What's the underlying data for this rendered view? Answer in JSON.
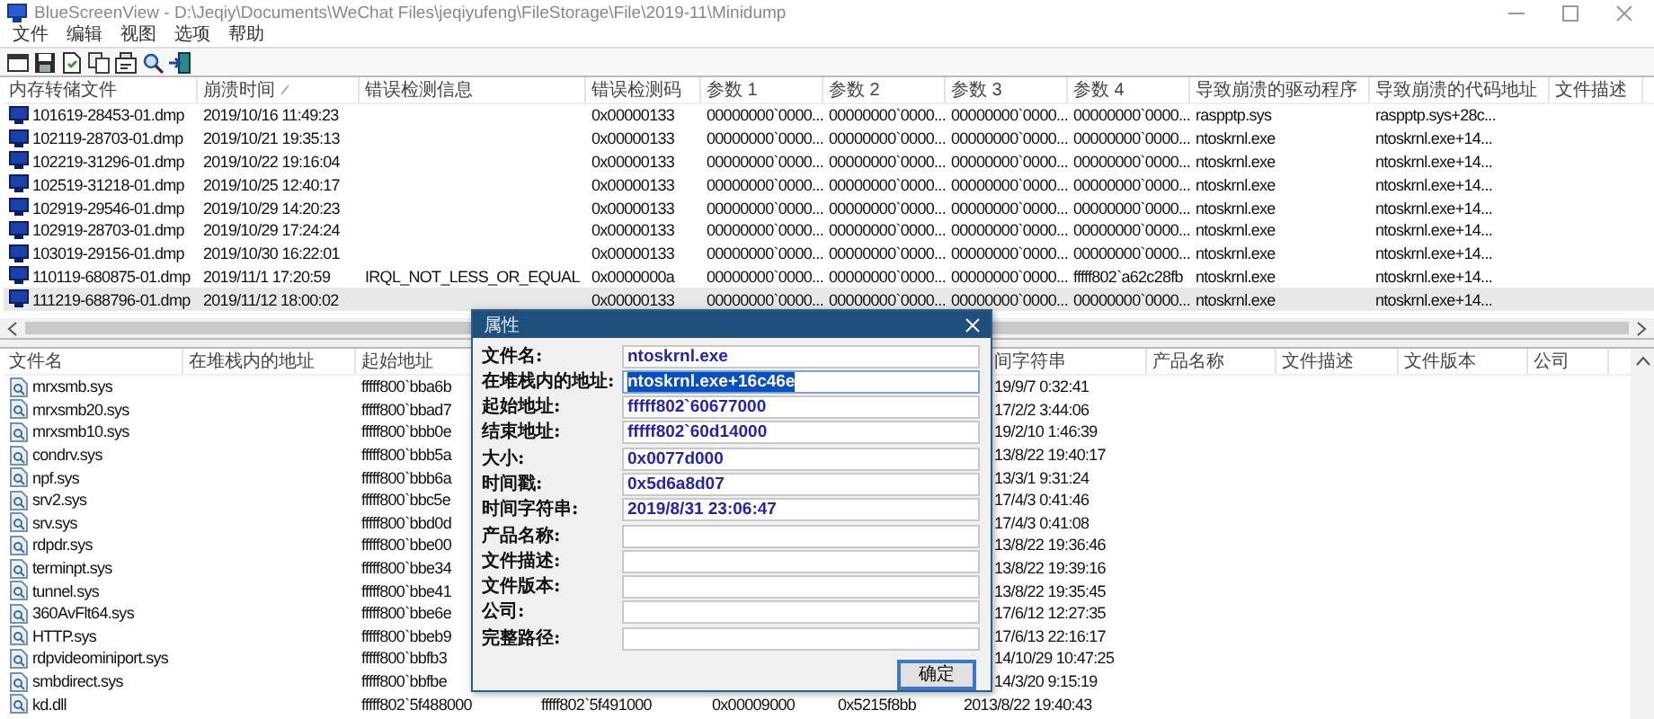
{
  "window": {
    "title": "BlueScreenView  -  D:\\Jeqiy\\Documents\\WeChat Files\\jeqiyufeng\\FileStorage\\File\\2019-11\\Minidump"
  },
  "menu": [
    "文件",
    "编辑",
    "视图",
    "选项",
    "帮助"
  ],
  "crash_list": {
    "columns": [
      {
        "label": "内存转储文件",
        "sorted": false
      },
      {
        "label": "崩溃时间",
        "sorted": true
      },
      {
        "label": "错误检测信息",
        "sorted": false
      },
      {
        "label": "错误检测码",
        "sorted": false
      },
      {
        "label": "参数 1",
        "sorted": false
      },
      {
        "label": "参数 2",
        "sorted": false
      },
      {
        "label": "参数 3",
        "sorted": false
      },
      {
        "label": "参数 4",
        "sorted": false
      },
      {
        "label": "导致崩溃的驱动程序",
        "sorted": false
      },
      {
        "label": "导致崩溃的代码地址",
        "sorted": false
      },
      {
        "label": "文件描述",
        "sorted": false
      }
    ],
    "rows": [
      {
        "file": "101619-28453-01.dmp",
        "time": "2019/10/16 11:49:23",
        "code": "0x00000133",
        "param1": "00000000`0000...",
        "param2": "00000000`0000...",
        "param3": "00000000`0000...",
        "param4": "00000000`0000...",
        "driver": "raspptp.sys",
        "address": "raspptp.sys+28c...",
        "selected": false
      },
      {
        "file": "102119-28703-01.dmp",
        "time": "2019/10/21 19:35:13",
        "code": "0x00000133",
        "param1": "00000000`0000...",
        "param2": "00000000`0000...",
        "param3": "00000000`0000...",
        "param4": "00000000`0000...",
        "driver": "ntoskrnl.exe",
        "address": "ntoskrnl.exe+14...",
        "selected": false
      },
      {
        "file": "102219-31296-01.dmp",
        "time": "2019/10/22 19:16:04",
        "code": "0x00000133",
        "param1": "00000000`0000...",
        "param2": "00000000`0000...",
        "param3": "00000000`0000...",
        "param4": "00000000`0000...",
        "driver": "ntoskrnl.exe",
        "address": "ntoskrnl.exe+14...",
        "selected": false
      },
      {
        "file": "102519-31218-01.dmp",
        "time": "2019/10/25 12:40:17",
        "code": "0x00000133",
        "param1": "00000000`0000...",
        "param2": "00000000`0000...",
        "param3": "00000000`0000...",
        "param4": "00000000`0000...",
        "driver": "ntoskrnl.exe",
        "address": "ntoskrnl.exe+14...",
        "selected": false
      },
      {
        "file": "102919-29546-01.dmp",
        "time": "2019/10/29 14:20:23",
        "code": "0x00000133",
        "param1": "00000000`0000...",
        "param2": "00000000`0000...",
        "param3": "00000000`0000...",
        "param4": "00000000`0000...",
        "driver": "ntoskrnl.exe",
        "address": "ntoskrnl.exe+14...",
        "selected": false
      },
      {
        "file": "102919-28703-01.dmp",
        "time": "2019/10/29 17:24:24",
        "code": "0x00000133",
        "param1": "00000000`0000...",
        "param2": "00000000`0000...",
        "param3": "00000000`0000...",
        "param4": "00000000`0000...",
        "driver": "ntoskrnl.exe",
        "address": "ntoskrnl.exe+14...",
        "selected": false
      },
      {
        "file": "103019-29156-01.dmp",
        "time": "2019/10/30 16:22:01",
        "code": "0x00000133",
        "param1": "00000000`0000...",
        "param2": "00000000`0000...",
        "param3": "00000000`0000...",
        "param4": "00000000`0000...",
        "driver": "ntoskrnl.exe",
        "address": "ntoskrnl.exe+14...",
        "selected": false
      },
      {
        "file": "110119-680875-01.dmp",
        "time": "2019/11/1 17:20:59",
        "message": "IRQL_NOT_LESS_OR_EQUAL",
        "code": "0x0000000a",
        "param1": "00000000`0000...",
        "param2": "00000000`0000...",
        "param3": "00000000`0000...",
        "param4": "fffff802`a62c28fb",
        "driver": "ntoskrnl.exe",
        "address": "ntoskrnl.exe+14...",
        "selected": false
      },
      {
        "file": "111219-688796-01.dmp",
        "time": "2019/11/12 18:00:02",
        "code": "0x00000133",
        "param1": "00000000`0000...",
        "param2": "00000000`0000...",
        "param3": "00000000`0000...",
        "param4": "00000000`0000...",
        "driver": "ntoskrnl.exe",
        "address": "ntoskrnl.exe+14...",
        "selected": true
      }
    ]
  },
  "module_list": {
    "columns_left": [
      "文件名",
      "在堆栈内的地址",
      "起始地址"
    ],
    "columns_right": [
      "间字符串",
      "产品名称",
      "文件描述",
      "文件版本",
      "公司"
    ],
    "rows": [
      {
        "name": "mrxsmb.sys",
        "start_address": "fffff800`bba6b",
        "time_string": "19/9/7 0:32:41",
        "covered": true
      },
      {
        "name": "mrxsmb20.sys",
        "start_address": "fffff800`bbad7",
        "time_string": "17/2/2 3:44:06",
        "covered": true
      },
      {
        "name": "mrxsmb10.sys",
        "start_address": "fffff800`bbb0e",
        "time_string": "19/2/10 1:46:39",
        "covered": true
      },
      {
        "name": "condrv.sys",
        "start_address": "fffff800`bbb5a",
        "time_string": "13/8/22 19:40:17",
        "covered": true
      },
      {
        "name": "npf.sys",
        "start_address": "fffff800`bbb6a",
        "time_string": "13/3/1 9:31:24",
        "covered": true
      },
      {
        "name": "srv2.sys",
        "start_address": "fffff800`bbc5e",
        "time_string": "17/4/3 0:41:46",
        "covered": true
      },
      {
        "name": "srv.sys",
        "start_address": "fffff800`bbd0d",
        "time_string": "17/4/3 0:41:08",
        "covered": true
      },
      {
        "name": "rdpdr.sys",
        "start_address": "fffff800`bbe00",
        "time_string": "13/8/22 19:36:46",
        "covered": true
      },
      {
        "name": "terminpt.sys",
        "start_address": "fffff800`bbe34",
        "time_string": "13/8/22 19:39:16",
        "covered": true
      },
      {
        "name": "tunnel.sys",
        "start_address": "fffff800`bbe41",
        "time_string": "13/8/22 19:35:45",
        "covered": true
      },
      {
        "name": "360AvFlt64.sys",
        "start_address": "fffff800`bbe6e",
        "time_string": "17/6/12 12:27:35",
        "covered": true
      },
      {
        "name": "HTTP.sys",
        "start_address": "fffff800`bbeb9",
        "time_string": "17/6/13 22:16:17",
        "covered": true
      },
      {
        "name": "rdpvideominiport.sys",
        "start_address": "fffff800`bbfb3",
        "time_string": "14/10/29 10:47:25",
        "covered": true
      },
      {
        "name": "smbdirect.sys",
        "start_address": "fffff800`bbfbe",
        "time_string": "14/3/20 9:15:19",
        "covered": true
      },
      {
        "name": "kd.dll",
        "start_address": "fffff802`5f488000",
        "end_address": "fffff802`5f491000",
        "size": "0x00009000",
        "timestamp": "0x5215f8bb",
        "time_string": "2013/8/22 19:40:43",
        "covered": false
      }
    ]
  },
  "dialog": {
    "title": "属性",
    "fields": [
      {
        "label": "文件名:",
        "value": "ntoskrnl.exe",
        "selected": false
      },
      {
        "label": "在堆栈内的地址:",
        "value": "ntoskrnl.exe+16c46e",
        "selected": true
      },
      {
        "label": "起始地址:",
        "value": "fffff802`60677000",
        "selected": false
      },
      {
        "label": "结束地址:",
        "value": "fffff802`60d14000",
        "selected": false
      },
      {
        "label": "大小:",
        "value": "0x0077d000",
        "selected": false
      },
      {
        "label": "时间戳:",
        "value": "0x5d6a8d07",
        "selected": false
      },
      {
        "label": "时间字符串:",
        "value": "2019/8/31 23:06:47",
        "selected": false
      },
      {
        "label": "产品名称:",
        "selected": false
      },
      {
        "label": "文件描述:",
        "selected": false
      },
      {
        "label": "文件版本:",
        "selected": false
      },
      {
        "label": "公司:",
        "selected": false
      },
      {
        "label": "完整路径:",
        "selected": false
      }
    ],
    "button": "确定"
  }
}
